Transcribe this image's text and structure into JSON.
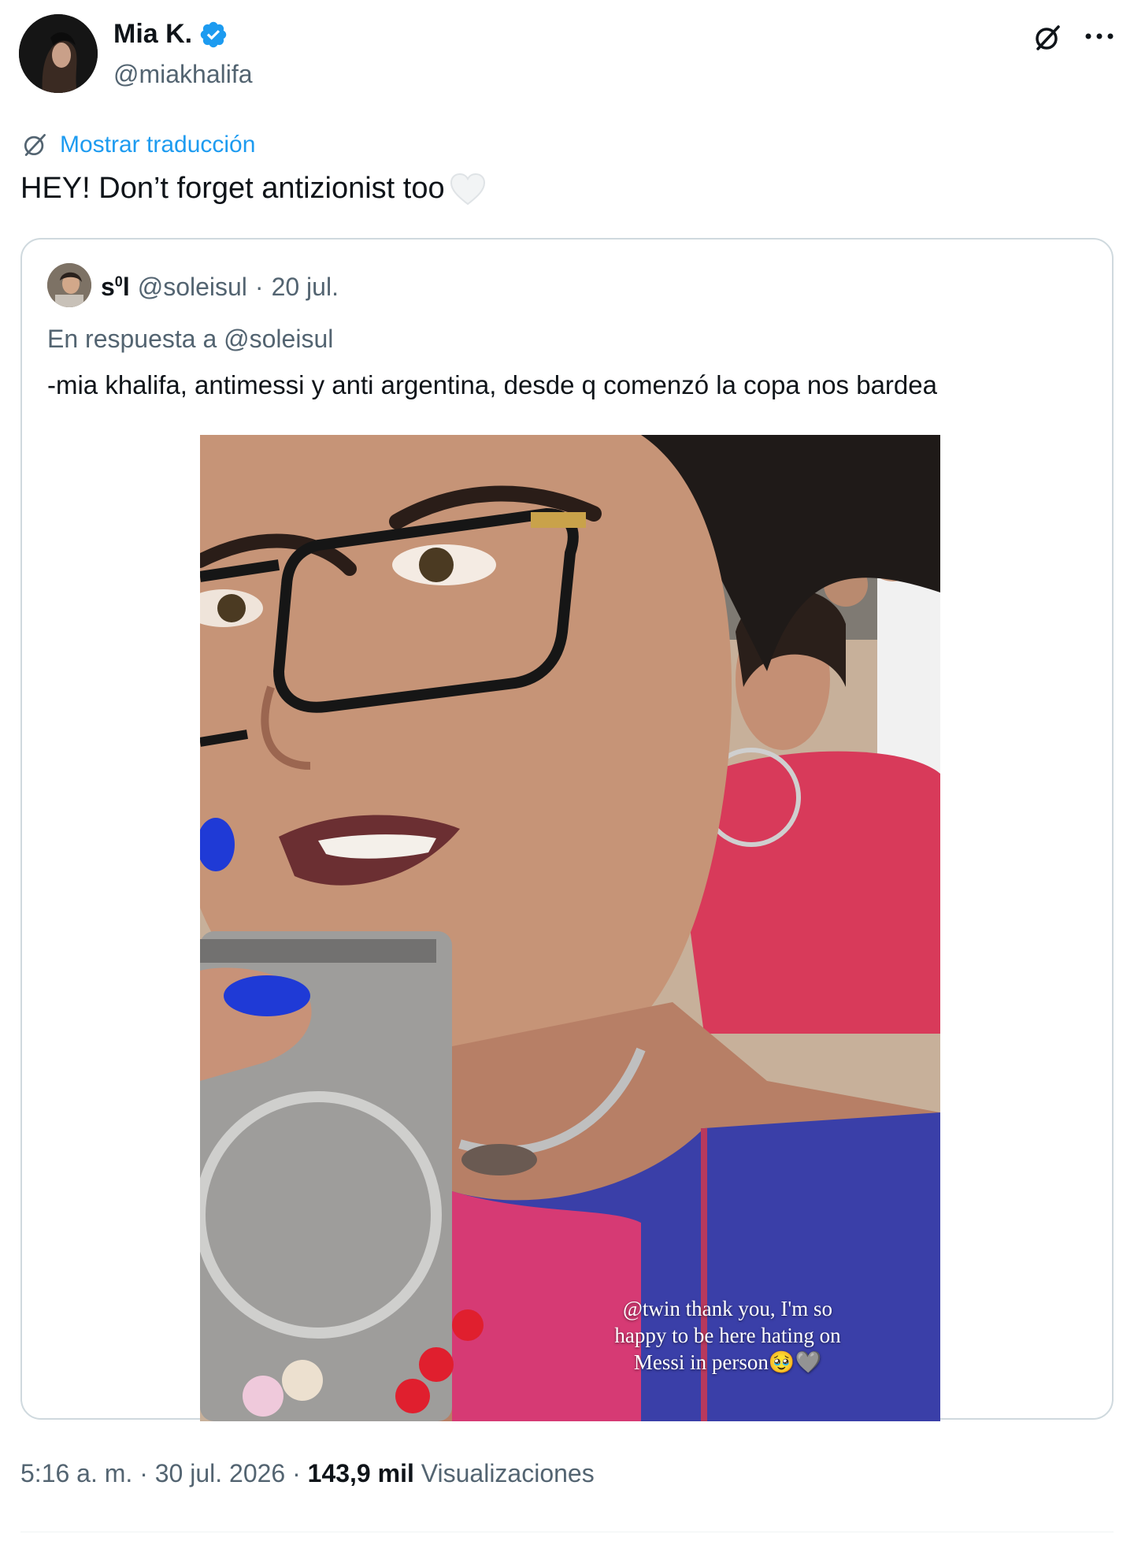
{
  "author": {
    "name": "Mia K.",
    "handle": "@miakhalifa",
    "verified": true,
    "avatar_icon": "user-avatar"
  },
  "translate": {
    "label": "Mostrar traducción",
    "icon": "translate-icon"
  },
  "tweet": {
    "text": "HEY! Don’t forget antizionist too",
    "emoji": "white-heart"
  },
  "quoted": {
    "name": "s",
    "name_sup": "0",
    "name_tail": "l",
    "handle": "@soleisul",
    "separator": "·",
    "date": "20 jul.",
    "reply_prefix": "En respuesta a",
    "reply_handle": "@soleisul",
    "text": "-mia khalifa, antimessi y anti argentina, desde q comenzó la copa nos bardea",
    "media_caption_line1": "@twin thank you, I'm so",
    "media_caption_line2": "happy to be here hating on",
    "media_caption_line3": "Messi in person🥹🩶"
  },
  "footer": {
    "time": "5:16 a. m.",
    "separator": "·",
    "date": "30 jul. 2026",
    "views_count": "143,9 mil",
    "views_label": "Visualizaciones"
  },
  "colors": {
    "accent": "#1d9bf0",
    "secondary_text": "#536471",
    "border": "#cfd9de"
  }
}
